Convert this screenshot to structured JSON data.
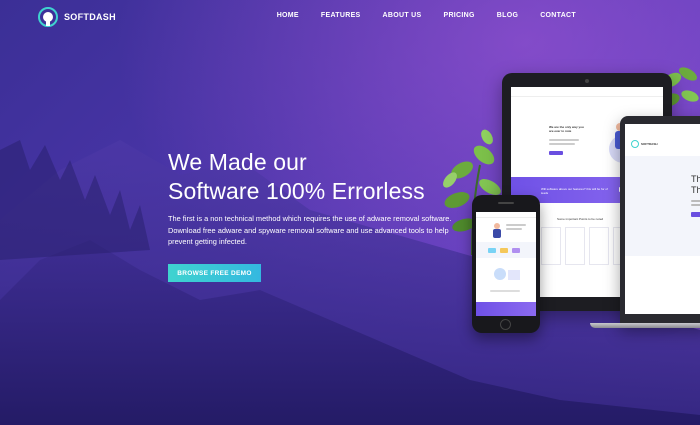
{
  "brand": {
    "name": "SOFTDASH"
  },
  "nav": {
    "items": [
      {
        "label": "HOME"
      },
      {
        "label": "FEATURES"
      },
      {
        "label": "ABOUT US"
      },
      {
        "label": "PRICING"
      },
      {
        "label": "BLOG"
      },
      {
        "label": "CONTACT"
      }
    ]
  },
  "hero": {
    "headline_line1": "We Made our",
    "headline_line2": "Software 100% Errorless",
    "description": "The first is a non technical method which requires the use of adware removal software. Download free adware and spyware removal software and use advanced tools to help prevent getting infected.",
    "cta_label": "BROWSE FREE DEMO"
  },
  "mockup": {
    "tablet_banner": "Will software above our features? this will be for of leads",
    "tablet_heading": "We are the only way you are ever to note",
    "tablet_features": "Some important Points to be noted",
    "laptop_brand": "SOFTDASH",
    "laptop_heading_1": "Th",
    "laptop_heading_2": "Th"
  },
  "colors": {
    "accent_gradient_start": "#3fd3cf",
    "accent_gradient_end": "#34b8e0",
    "bg_start": "#3b2f96",
    "bg_end": "#7d4fd0"
  },
  "icons": [
    "softdash-logo-icon"
  ]
}
